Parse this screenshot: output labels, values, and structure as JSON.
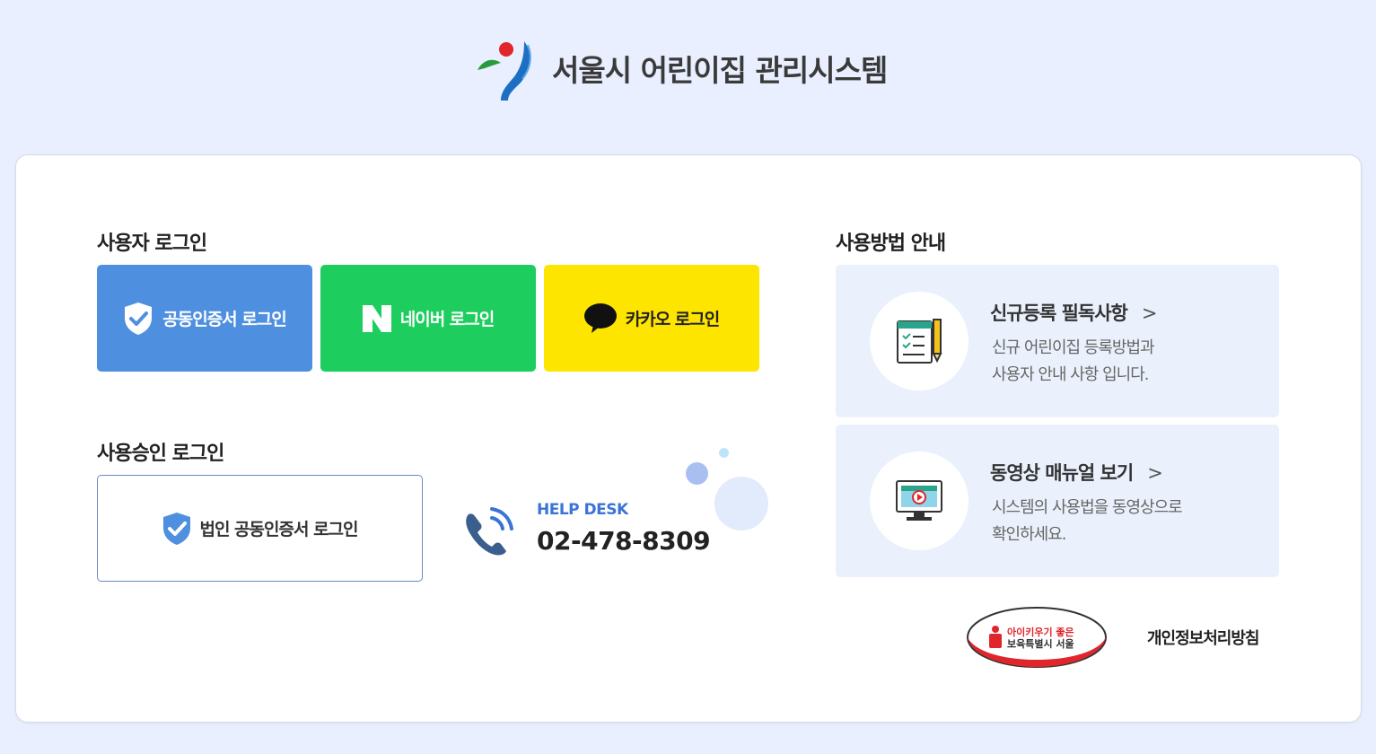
{
  "header": {
    "site_title": "서울시 어린이집 관리시스템"
  },
  "user_login": {
    "title": "사용자 로그인",
    "cert_label": "공동인증서 로그인",
    "naver_label": "네이버 로그인",
    "kakao_label": "카카오 로그인"
  },
  "approval_login": {
    "title": "사용승인 로그인",
    "corp_cert_label": "법인 공동인증서 로그인"
  },
  "helpdesk": {
    "label": "HELP DESK",
    "number": "02-478-8309"
  },
  "guide": {
    "title": "사용방법 안내",
    "items": [
      {
        "title": "신규등록 필독사항",
        "desc": "신규 어린이집 등록방법과\n사용자 안내 사항 입니다."
      },
      {
        "title": "동영상 매뉴얼 보기",
        "desc": "시스템의 사용법을 동영상으로\n확인하세요."
      }
    ]
  },
  "footer": {
    "badge_text_line1": "아이키우기 좋은",
    "badge_text_line2": "보육특별시 서울",
    "privacy_label": "개인정보처리방침"
  },
  "colors": {
    "background": "#e9efff",
    "cert_button": "#4f8fe0",
    "naver_button": "#1dce5f",
    "kakao_button": "#fee500",
    "helpdesk_accent": "#3b74d6",
    "guide_box": "#eaf1fc"
  }
}
